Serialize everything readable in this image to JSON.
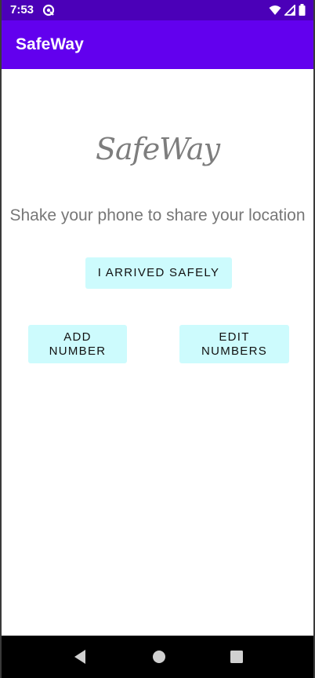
{
  "status_bar": {
    "time": "7:53",
    "background": "#4b00b8",
    "icons": [
      "app-notification-icon",
      "wifi-icon",
      "signal-icon",
      "battery-icon"
    ]
  },
  "app_bar": {
    "title": "SafeWay",
    "background": "#6200ee"
  },
  "main": {
    "logo_text": "SafeWay",
    "subtitle": "Shake your phone to share your location",
    "buttons": {
      "arrived_label": "I ARRIVED SAFELY",
      "add_label": "ADD NUMBER",
      "edit_label": "EDIT NUMBERS"
    },
    "button_color": "#cdfbfd"
  },
  "nav_bar": {
    "icons": [
      "back-icon",
      "home-icon",
      "recent-apps-icon"
    ]
  }
}
